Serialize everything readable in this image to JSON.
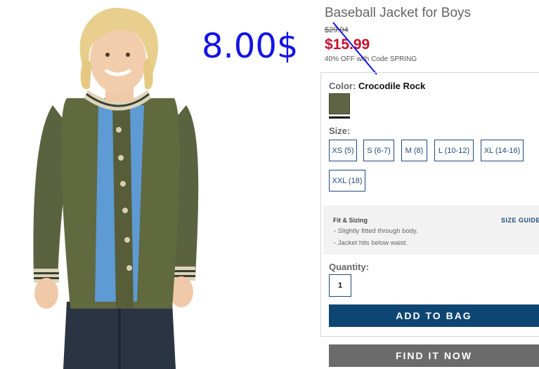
{
  "overlay": {
    "price_text": "8.00$"
  },
  "product": {
    "title": "Baseball Jacket for Boys",
    "old_price": "$29.94",
    "sale_price": "$15.99",
    "promo": "40% OFF with Code SPRING"
  },
  "color": {
    "label": "Color:",
    "value": "Crocodile Rock",
    "swatch_hex": "#5f6445"
  },
  "size": {
    "label": "Size:",
    "options": [
      "XS (5)",
      "S (6-7)",
      "M (8)",
      "L (10-12)",
      "XL (14-16)",
      "XXL (18)"
    ]
  },
  "fit": {
    "title": "Fit & Sizing",
    "size_guide": "SIZE GUIDE",
    "lines": [
      "- Slightly fitted through body.",
      "- Jacket hits below waist."
    ]
  },
  "quantity": {
    "label": "Quantity:",
    "value": "1"
  },
  "actions": {
    "add_to_bag": "ADD TO BAG",
    "find_it_now": "FIND IT NOW"
  },
  "colors": {
    "brand_blue": "#0e4673",
    "sale_red": "#c8102e",
    "annotation_blue": "#1414e6"
  }
}
